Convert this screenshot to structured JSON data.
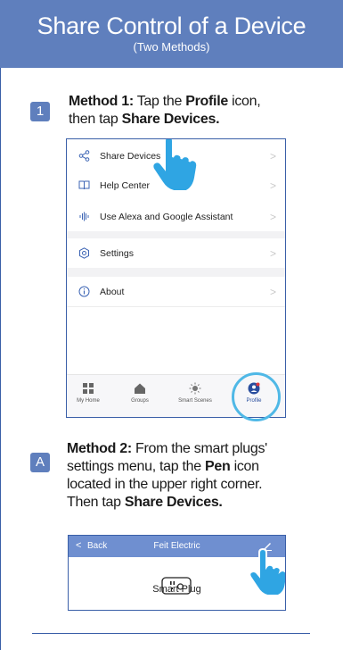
{
  "header": {
    "title": "Share Control of a Device",
    "subtitle": "(Two Methods)"
  },
  "method1": {
    "badge": "1",
    "lead": "Method 1:",
    "text_a": " Tap the ",
    "profile": "Profile",
    "text_b": " icon,",
    "text_c": "then tap ",
    "share": "Share Devices."
  },
  "profile_screen": {
    "menu": [
      {
        "label": "Share Devices",
        "icon": "share-icon"
      },
      {
        "label": "Help Center",
        "icon": "book-icon"
      },
      {
        "label": "Use Alexa and Google Assistant",
        "icon": "voice-wave-icon"
      },
      {
        "label": "Settings",
        "icon": "settings-icon"
      },
      {
        "label": "About",
        "icon": "info-icon"
      }
    ],
    "tabs": [
      {
        "label": "My Home",
        "icon": "grid-icon"
      },
      {
        "label": "Groups",
        "icon": "house-icon"
      },
      {
        "label": "Smart Scenes",
        "icon": "sun-icon"
      },
      {
        "label": "Profile",
        "icon": "profile-icon"
      }
    ],
    "highlight_color": "#4fb8e6",
    "accent_color": "#3c64b4"
  },
  "method2": {
    "badge": "A",
    "lead": "Method 2:",
    "line1_rest": " From the smart plugs'",
    "line2_a": "settings menu, tap the ",
    "pen": "Pen",
    "line2_b": " icon",
    "line3": "located in the upper right corner.",
    "line4_a": "Then tap ",
    "share": "Share Devices."
  },
  "device_screen": {
    "back_label": "Back",
    "title": "Feit Electric",
    "device_name": "Smart Plug",
    "header_color": "#6f8fd0"
  },
  "colors": {
    "banner": "#5f7fbd",
    "border": "#3a5fa8",
    "hand": "#2fa5e3"
  }
}
